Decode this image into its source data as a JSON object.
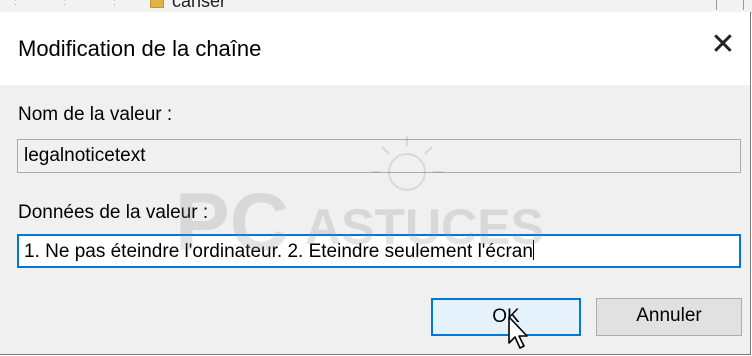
{
  "background": {
    "fragment_text": "cahser"
  },
  "dialog": {
    "title": "Modification de la chaîne",
    "close_glyph": "✕",
    "value_name_label": "Nom de la valeur :",
    "value_name": "legalnoticetext",
    "value_data_label": "Données de la valeur :",
    "value_data": "1. Ne pas éteindre l'ordinateur. 2. Eteindre seulement l'écran",
    "ok_label": "OK",
    "cancel_label": "Annuler",
    "accent_color": "#0078d7"
  },
  "watermark": {
    "brand_big": "PC",
    "brand_small": "ASTUCES"
  }
}
